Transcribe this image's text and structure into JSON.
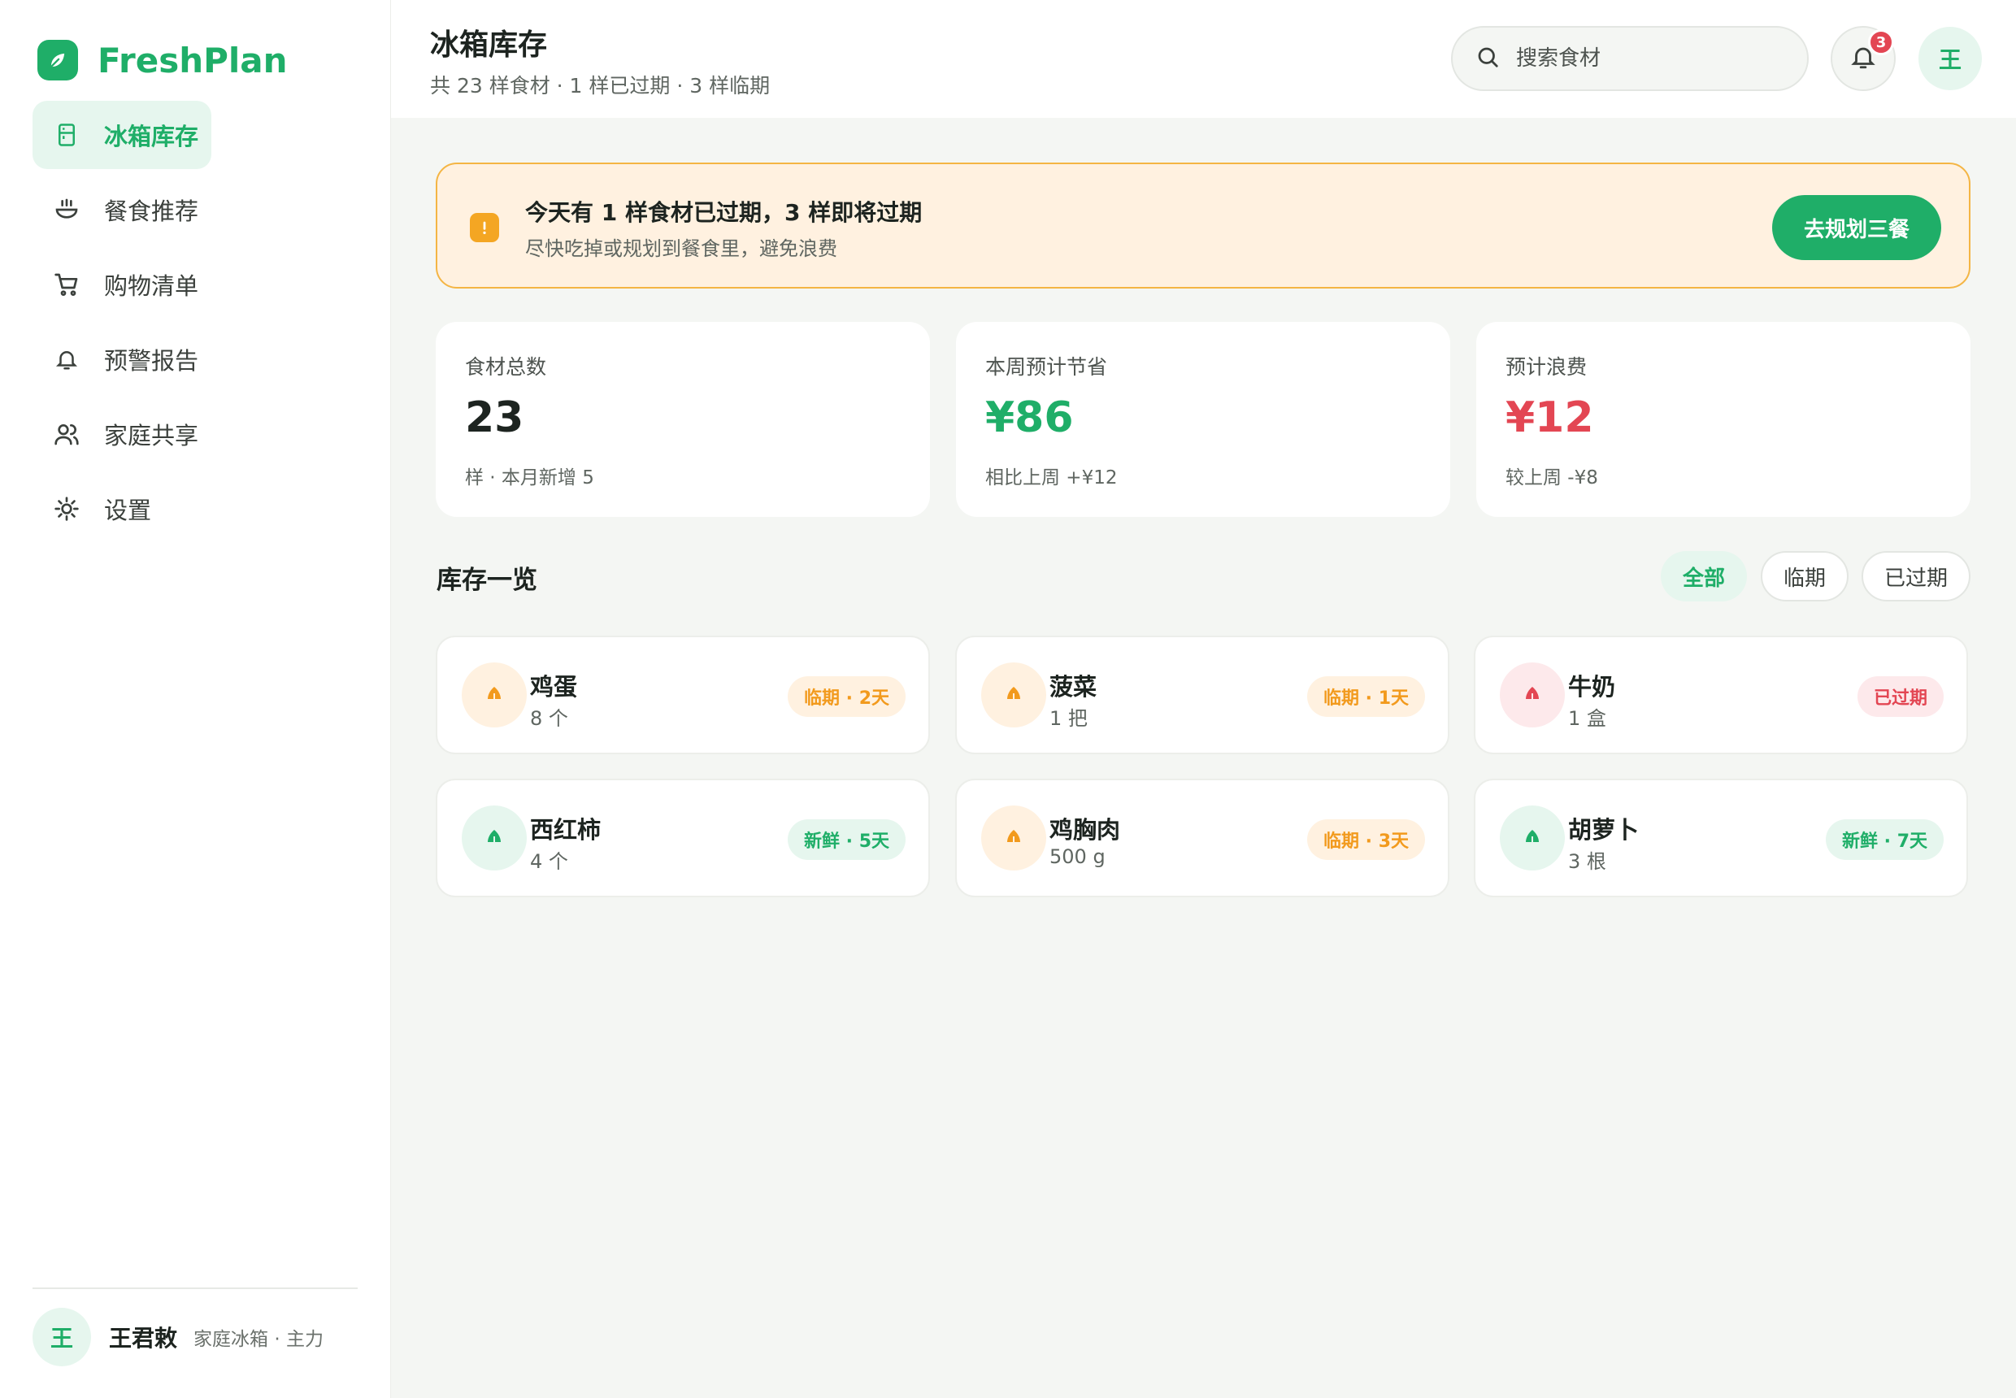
{
  "brand": {
    "name": "FreshPlan",
    "logo_icon": "leaf-icon",
    "color": "#1fae68"
  },
  "sidebar": {
    "items": [
      {
        "label": "冰箱库存",
        "icon": "fridge-icon",
        "active": true
      },
      {
        "label": "餐食推荐",
        "icon": "bowl-icon",
        "active": false
      },
      {
        "label": "购物清单",
        "icon": "cart-icon",
        "active": false
      },
      {
        "label": "预警报告",
        "icon": "bell-icon",
        "active": false
      },
      {
        "label": "家庭共享",
        "icon": "users-icon",
        "active": false
      },
      {
        "label": "设置",
        "icon": "gear-icon",
        "active": false
      }
    ],
    "user": {
      "avatar": "王",
      "name": "王君敕",
      "meta": "家庭冰箱 · 主力"
    }
  },
  "header": {
    "title": "冰箱库存",
    "subtitle": "共 23 样食材 · 1 样已过期 · 3 样临期",
    "search_placeholder": "搜索食材",
    "notification_count": "3",
    "avatar": "王"
  },
  "alert": {
    "title": "今天有 1 样食材已过期，3 样即将过期",
    "subtitle": "尽快吃掉或规划到餐食里，避免浪费",
    "button": "去规划三餐"
  },
  "stats": [
    {
      "label": "食材总数",
      "value": "23",
      "note": "样 · 本月新增 5",
      "color": "#1d2420"
    },
    {
      "label": "本周预计节省",
      "value": "¥86",
      "note": "相比上周 +¥12",
      "color": "#1fae68"
    },
    {
      "label": "预计浪费",
      "value": "¥12",
      "note": "较上周 -¥8",
      "color": "#e34653"
    }
  ],
  "inventory": {
    "title": "库存一览",
    "filters": [
      {
        "label": "全部",
        "active": true
      },
      {
        "label": "临期",
        "active": false
      },
      {
        "label": "已过期",
        "active": false
      }
    ],
    "items": [
      {
        "name": "鸡蛋",
        "qty": "8 个",
        "tag": "临期 · 2天",
        "status": "soon"
      },
      {
        "name": "菠菜",
        "qty": "1 把",
        "tag": "临期 · 1天",
        "status": "soon"
      },
      {
        "name": "牛奶",
        "qty": "1 盒",
        "tag": "已过期",
        "status": "expired"
      },
      {
        "name": "西红柿",
        "qty": "4 个",
        "tag": "新鲜 · 5天",
        "status": "fresh"
      },
      {
        "name": "鸡胸肉",
        "qty": "500 g",
        "tag": "临期 · 3天",
        "status": "soon"
      },
      {
        "name": "胡萝卜",
        "qty": "3 根",
        "tag": "新鲜 · 7天",
        "status": "fresh"
      }
    ]
  },
  "status_colors": {
    "soon": {
      "fg": "#f29a1d",
      "bg": "#fff1e0"
    },
    "expired": {
      "fg": "#e34653",
      "bg": "#fde9eb"
    },
    "fresh": {
      "fg": "#1fae68",
      "bg": "#e6f6ee"
    }
  }
}
